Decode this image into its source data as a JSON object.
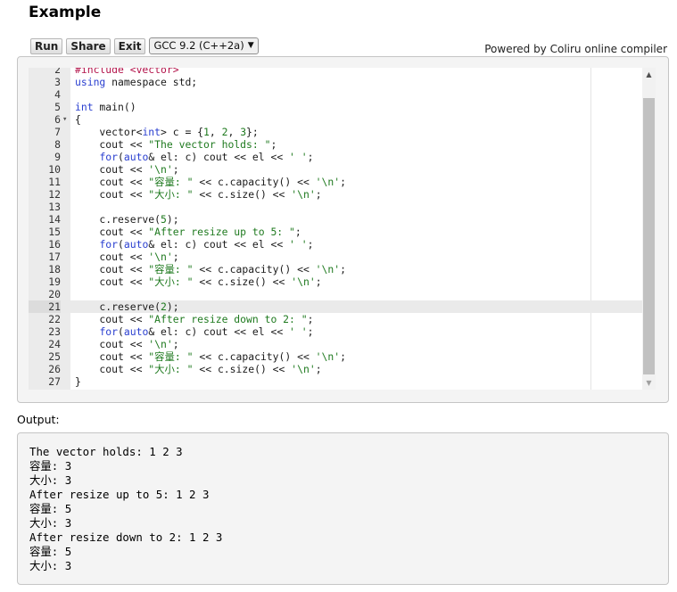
{
  "page": {
    "title": "Example",
    "powered_prefix": "Powered by ",
    "powered_link": "Coliru online compiler"
  },
  "toolbar": {
    "run_label": "Run",
    "share_label": "Share",
    "exit_label": "Exit",
    "compiler_selected": "GCC 9.2 (C++2a)"
  },
  "editor": {
    "active_line": 21,
    "lines": [
      {
        "n": 2,
        "code": [
          [
            "inc",
            "#include <vector>"
          ]
        ]
      },
      {
        "n": 3,
        "code": [
          [
            "kw",
            "using"
          ],
          [
            "t",
            " namespace std;"
          ]
        ]
      },
      {
        "n": 4,
        "code": []
      },
      {
        "n": 5,
        "code": [
          [
            "kw",
            "int"
          ],
          [
            "t",
            " main()"
          ]
        ]
      },
      {
        "n": 6,
        "fold": true,
        "code": [
          [
            "t",
            "{"
          ]
        ]
      },
      {
        "n": 7,
        "code": [
          [
            "t",
            "    vector<"
          ],
          [
            "kw",
            "int"
          ],
          [
            "t",
            "> c = {"
          ],
          [
            "num",
            "1"
          ],
          [
            "t",
            ", "
          ],
          [
            "num",
            "2"
          ],
          [
            "t",
            ", "
          ],
          [
            "num",
            "3"
          ],
          [
            "t",
            "};"
          ]
        ]
      },
      {
        "n": 8,
        "code": [
          [
            "t",
            "    cout << "
          ],
          [
            "str",
            "\"The vector holds: \""
          ],
          [
            "t",
            ";"
          ]
        ]
      },
      {
        "n": 9,
        "code": [
          [
            "t",
            "    "
          ],
          [
            "kw",
            "for"
          ],
          [
            "t",
            "("
          ],
          [
            "kw",
            "auto"
          ],
          [
            "t",
            "& el: c) cout << el << "
          ],
          [
            "str",
            "' '"
          ],
          [
            "t",
            ";"
          ]
        ]
      },
      {
        "n": 10,
        "code": [
          [
            "t",
            "    cout << "
          ],
          [
            "str",
            "'\\n'"
          ],
          [
            "t",
            ";"
          ]
        ]
      },
      {
        "n": 11,
        "code": [
          [
            "t",
            "    cout << "
          ],
          [
            "str",
            "\"容量: \""
          ],
          [
            "t",
            " << c.capacity() << "
          ],
          [
            "str",
            "'\\n'"
          ],
          [
            "t",
            ";"
          ]
        ]
      },
      {
        "n": 12,
        "code": [
          [
            "t",
            "    cout << "
          ],
          [
            "str",
            "\"大小: \""
          ],
          [
            "t",
            " << c.size() << "
          ],
          [
            "str",
            "'\\n'"
          ],
          [
            "t",
            ";"
          ]
        ]
      },
      {
        "n": 13,
        "code": []
      },
      {
        "n": 14,
        "code": [
          [
            "t",
            "    c.reserve("
          ],
          [
            "num",
            "5"
          ],
          [
            "t",
            ");"
          ]
        ]
      },
      {
        "n": 15,
        "code": [
          [
            "t",
            "    cout << "
          ],
          [
            "str",
            "\"After resize up to 5: \""
          ],
          [
            "t",
            ";"
          ]
        ]
      },
      {
        "n": 16,
        "code": [
          [
            "t",
            "    "
          ],
          [
            "kw",
            "for"
          ],
          [
            "t",
            "("
          ],
          [
            "kw",
            "auto"
          ],
          [
            "t",
            "& el: c) cout << el << "
          ],
          [
            "str",
            "' '"
          ],
          [
            "t",
            ";"
          ]
        ]
      },
      {
        "n": 17,
        "code": [
          [
            "t",
            "    cout << "
          ],
          [
            "str",
            "'\\n'"
          ],
          [
            "t",
            ";"
          ]
        ]
      },
      {
        "n": 18,
        "code": [
          [
            "t",
            "    cout << "
          ],
          [
            "str",
            "\"容量: \""
          ],
          [
            "t",
            " << c.capacity() << "
          ],
          [
            "str",
            "'\\n'"
          ],
          [
            "t",
            ";"
          ]
        ]
      },
      {
        "n": 19,
        "code": [
          [
            "t",
            "    cout << "
          ],
          [
            "str",
            "\"大小: \""
          ],
          [
            "t",
            " << c.size() << "
          ],
          [
            "str",
            "'\\n'"
          ],
          [
            "t",
            ";"
          ]
        ]
      },
      {
        "n": 20,
        "code": []
      },
      {
        "n": 21,
        "code": [
          [
            "t",
            "    c.reserve("
          ],
          [
            "num",
            "2"
          ],
          [
            "t",
            ");"
          ]
        ]
      },
      {
        "n": 22,
        "code": [
          [
            "t",
            "    cout << "
          ],
          [
            "str",
            "\"After resize down to 2: \""
          ],
          [
            "t",
            ";"
          ]
        ]
      },
      {
        "n": 23,
        "code": [
          [
            "t",
            "    "
          ],
          [
            "kw",
            "for"
          ],
          [
            "t",
            "("
          ],
          [
            "kw",
            "auto"
          ],
          [
            "t",
            "& el: c) cout << el << "
          ],
          [
            "str",
            "' '"
          ],
          [
            "t",
            ";"
          ]
        ]
      },
      {
        "n": 24,
        "code": [
          [
            "t",
            "    cout << "
          ],
          [
            "str",
            "'\\n'"
          ],
          [
            "t",
            ";"
          ]
        ]
      },
      {
        "n": 25,
        "code": [
          [
            "t",
            "    cout << "
          ],
          [
            "str",
            "\"容量: \""
          ],
          [
            "t",
            " << c.capacity() << "
          ],
          [
            "str",
            "'\\n'"
          ],
          [
            "t",
            ";"
          ]
        ]
      },
      {
        "n": 26,
        "code": [
          [
            "t",
            "    cout << "
          ],
          [
            "str",
            "\"大小: \""
          ],
          [
            "t",
            " << c.size() << "
          ],
          [
            "str",
            "'\\n'"
          ],
          [
            "t",
            ";"
          ]
        ]
      },
      {
        "n": 27,
        "code": [
          [
            "t",
            "}"
          ]
        ]
      }
    ]
  },
  "output": {
    "label": "Output:",
    "lines": [
      "The vector holds: 1 2 3",
      "容量: 3",
      "大小: 3",
      "After resize up to 5: 1 2 3",
      "容量: 5",
      "大小: 3",
      "After resize down to 2: 1 2 3",
      "容量: 5",
      "大小: 3"
    ]
  },
  "icons": {
    "scroll_up": "triangle-up-icon",
    "scroll_down": "triangle-down-icon",
    "fold": "fold-arrow-icon",
    "select_chevron": "chevron-down-icon"
  }
}
